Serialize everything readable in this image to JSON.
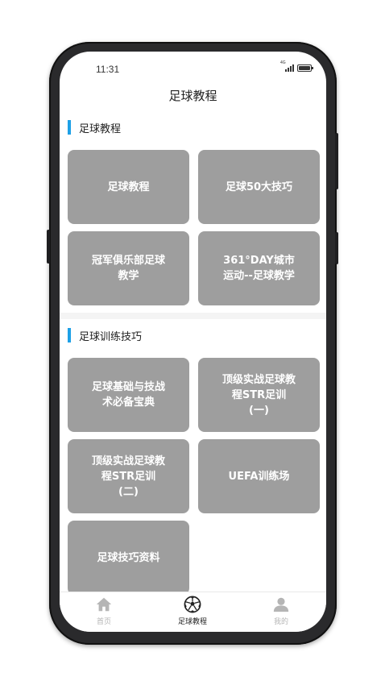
{
  "status_bar": {
    "time": "11:31",
    "network": "4G"
  },
  "header": {
    "title": "足球教程"
  },
  "sections": [
    {
      "title": "足球教程",
      "cards": [
        {
          "label": "足球教程"
        },
        {
          "label": "足球50大技巧"
        },
        {
          "label": "冠军俱乐部足球\n教学"
        },
        {
          "label": "361°DAY城市\n运动--足球教学"
        }
      ]
    },
    {
      "title": "足球训练技巧",
      "cards": [
        {
          "label": "足球基础与技战\n术必备宝典"
        },
        {
          "label": "顶级实战足球教\n程STR足训\n(一)"
        },
        {
          "label": "顶级实战足球教\n程STR足训\n(二)"
        },
        {
          "label": "UEFA训练场"
        },
        {
          "label": "足球技巧资料"
        }
      ]
    }
  ],
  "tabbar": {
    "items": [
      {
        "label": "首页",
        "icon": "home-icon",
        "active": false
      },
      {
        "label": "足球教程",
        "icon": "soccer-ball-icon",
        "active": true
      },
      {
        "label": "我的",
        "icon": "user-icon",
        "active": false
      }
    ],
    "active_color": "#222222",
    "inactive_color": "#b5b5b5"
  },
  "colors": {
    "accent": "#1ea0e6",
    "card_bg": "#9e9e9e",
    "card_text": "#ffffff"
  }
}
